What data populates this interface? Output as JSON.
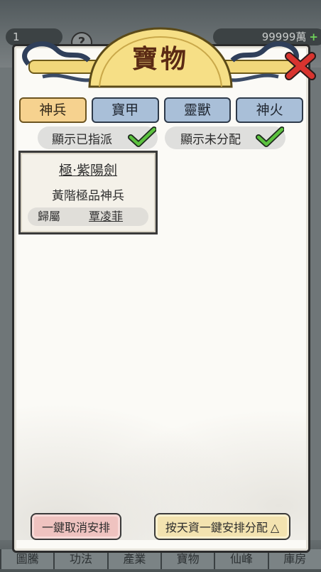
{
  "background": {
    "resource_left": "1",
    "resource_right": "99999萬",
    "nav_tabs": [
      "圖騰",
      "功法",
      "產業",
      "寶物",
      "仙峰",
      "庫房"
    ]
  },
  "header": {
    "title": "寶物",
    "help_label": "?"
  },
  "tabs": [
    {
      "label": "神兵",
      "active": true
    },
    {
      "label": "寶甲",
      "active": false
    },
    {
      "label": "靈獸",
      "active": false
    },
    {
      "label": "神火",
      "active": false
    }
  ],
  "filters": {
    "show_assigned": {
      "label": "顯示已指派",
      "checked": true
    },
    "show_unassigned": {
      "label": "顯示未分配",
      "checked": true
    }
  },
  "items": [
    {
      "name": "極·紫陽劍",
      "grade": "黃階極品神兵",
      "owner_label": "歸屬",
      "owner": "覃凌菲"
    }
  ],
  "actions": {
    "cancel_all": "一鍵取消安排",
    "auto_assign": "按天資一鍵安排分配"
  },
  "colors": {
    "tab_active": "#f6d28f",
    "tab_inactive": "#a9bfd8",
    "check_green": "#5cc23f",
    "close_red": "#d8342f",
    "banner_gold": "#f1d77a"
  }
}
